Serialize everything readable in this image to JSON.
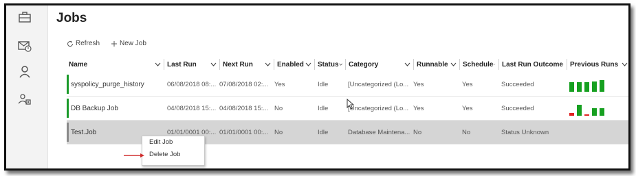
{
  "page": {
    "title": "Jobs"
  },
  "sidebar": {
    "icons": [
      "briefcase-icon",
      "mail-alert-icon",
      "user-icon",
      "users-gear-icon"
    ]
  },
  "toolbar": {
    "refresh_label": "Refresh",
    "new_job_label": "New Job"
  },
  "columns": [
    {
      "label": "Name",
      "chevron": true
    },
    {
      "label": "Last Run",
      "chevron": true
    },
    {
      "label": "Next Run",
      "chevron": true
    },
    {
      "label": "Enabled",
      "chevron": true
    },
    {
      "label": "Status",
      "chevron": true
    },
    {
      "label": "Category",
      "chevron": true
    },
    {
      "label": "Runnable",
      "chevron": true
    },
    {
      "label": "Schedule",
      "chevron": true
    },
    {
      "label": "Last Run Outcome",
      "chevron": true
    },
    {
      "label": "Previous Runs",
      "chevron": true
    }
  ],
  "rows": [
    {
      "name": "syspolicy_purge_history",
      "last_run": "06/08/2018 08:...",
      "next_run": "07/08/2018 02:...",
      "enabled": "Yes",
      "status": "Idle",
      "category": "[Uncategorized (Lo...",
      "runnable": "Yes",
      "schedule": "Yes",
      "outcome": "Succeeded",
      "status_color": "#1a9a2a"
    },
    {
      "name": "DB Backup Job",
      "last_run": "04/08/2018 15:...",
      "next_run": "04/08/2018 15:...",
      "enabled": "No",
      "status": "Idle",
      "category": "[Uncategorized (Lo...",
      "runnable": "Yes",
      "schedule": "Yes",
      "outcome": "Succeeded",
      "status_color": "#1a9a2a"
    },
    {
      "name": "Test.Job",
      "last_run": "01/01/0001 00:...",
      "next_run": "01/01/0001 00:...",
      "enabled": "No",
      "status": "Idle",
      "category": "Database Maintena...",
      "runnable": "No",
      "schedule": "No",
      "outcome": "Status Unknown",
      "status_color": "#8a8a8a"
    }
  ],
  "previous_runs": [
    {
      "row": 0,
      "bars": [
        {
          "level": 0.7,
          "result": "success"
        },
        {
          "level": 0.7,
          "result": "success"
        },
        {
          "level": 0.7,
          "result": "success"
        },
        {
          "level": 0.75,
          "result": "success"
        },
        {
          "level": 0.85,
          "result": "success"
        }
      ]
    },
    {
      "row": 1,
      "bars": [
        {
          "level": 0.2,
          "result": "failure"
        },
        {
          "level": 0.8,
          "result": "success"
        },
        {
          "level": 0.1,
          "result": "failure"
        },
        {
          "level": 0.55,
          "result": "success"
        },
        {
          "level": 0.55,
          "result": "success"
        }
      ]
    }
  ],
  "colors": {
    "success": "#16a020",
    "failure": "#e02020",
    "unknown": "#8a8a8a",
    "arrow": "#d03030"
  },
  "context_menu": {
    "items": [
      "Edit Job",
      "Delete Job"
    ]
  }
}
